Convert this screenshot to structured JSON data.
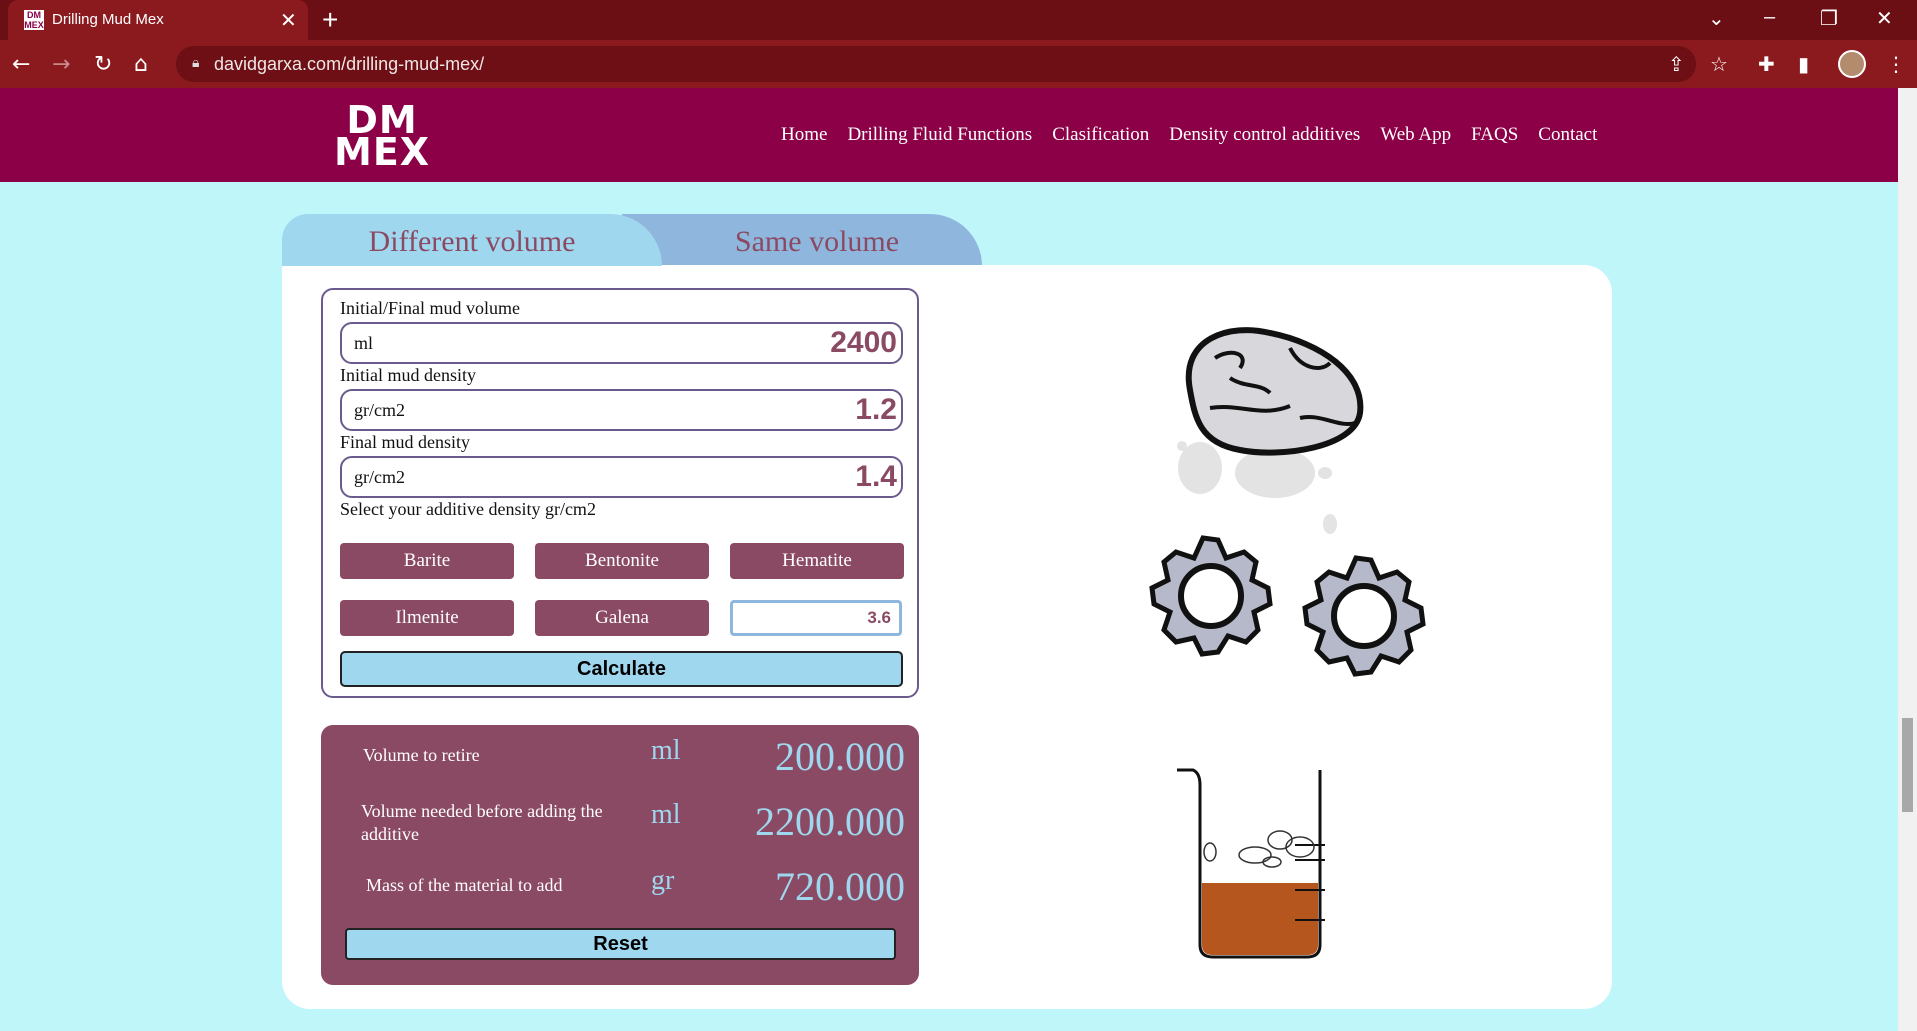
{
  "browser": {
    "tab_title": "Drilling Mud Mex",
    "favicon_text": "DM MEX",
    "url": "davidgarxa.com/drilling-mud-mex/"
  },
  "header": {
    "logo_line1": "DM",
    "logo_line2": "MEX",
    "nav": [
      "Home",
      "Drilling Fluid Functions",
      "Clasification",
      "Density control additives",
      "Web App",
      "FAQS",
      "Contact"
    ]
  },
  "tabs": {
    "different": "Different volume",
    "same": "Same volume"
  },
  "form": {
    "volume_label": "Initial/Final mud volume",
    "volume_unit": "ml",
    "volume_value": "2400",
    "initial_density_label": "Initial mud density",
    "initial_density_unit": "gr/cm2",
    "initial_density_value": "1.2",
    "final_density_label": "Final mud density",
    "final_density_unit": "gr/cm2",
    "final_density_value": "1.4",
    "additive_prompt": "Select your additive density gr/cm2",
    "additives": [
      "Barite",
      "Bentonite",
      "Hematite",
      "Ilmenite",
      "Galena"
    ],
    "custom_density": "3.6",
    "calculate": "Calculate"
  },
  "results": {
    "rows": [
      {
        "label": "Volume to retire",
        "unit": "ml",
        "value": "200.000"
      },
      {
        "label": "Volume needed before adding the additive",
        "unit": "ml",
        "value": "2200.000"
      },
      {
        "label": "Mass of the material to add",
        "unit": "gr",
        "value": "720.000"
      }
    ],
    "reset": "Reset"
  },
  "colors": {
    "brand": "#8b0046",
    "accent": "#8b4a63",
    "light_blue": "#9fd7ef",
    "background": "#bff6fa",
    "mud": "#b5561f"
  }
}
